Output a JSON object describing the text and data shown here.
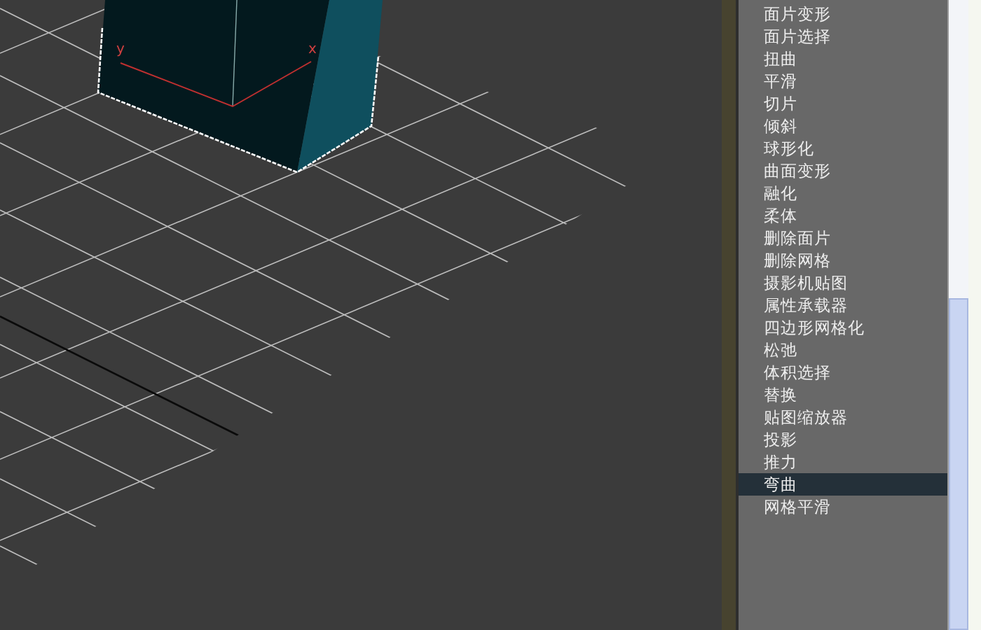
{
  "viewport": {
    "axis_labels": [
      "y",
      "x"
    ]
  },
  "modifier_list": {
    "items": [
      {
        "label": "面片变形",
        "selected": false
      },
      {
        "label": "面片选择",
        "selected": false
      },
      {
        "label": "扭曲",
        "selected": false
      },
      {
        "label": "平滑",
        "selected": false
      },
      {
        "label": "切片",
        "selected": false
      },
      {
        "label": "倾斜",
        "selected": false
      },
      {
        "label": "球形化",
        "selected": false
      },
      {
        "label": "曲面变形",
        "selected": false
      },
      {
        "label": "融化",
        "selected": false
      },
      {
        "label": "柔体",
        "selected": false
      },
      {
        "label": "删除面片",
        "selected": false
      },
      {
        "label": "删除网格",
        "selected": false
      },
      {
        "label": "摄影机贴图",
        "selected": false
      },
      {
        "label": "属性承载器",
        "selected": false
      },
      {
        "label": "四边形网格化",
        "selected": false
      },
      {
        "label": "松弛",
        "selected": false
      },
      {
        "label": "体积选择",
        "selected": false
      },
      {
        "label": "替换",
        "selected": false
      },
      {
        "label": "贴图缩放器",
        "selected": false
      },
      {
        "label": "投影",
        "selected": false
      },
      {
        "label": "推力",
        "selected": false
      },
      {
        "label": "弯曲",
        "selected": true
      },
      {
        "label": "网格平滑",
        "selected": false
      }
    ]
  }
}
